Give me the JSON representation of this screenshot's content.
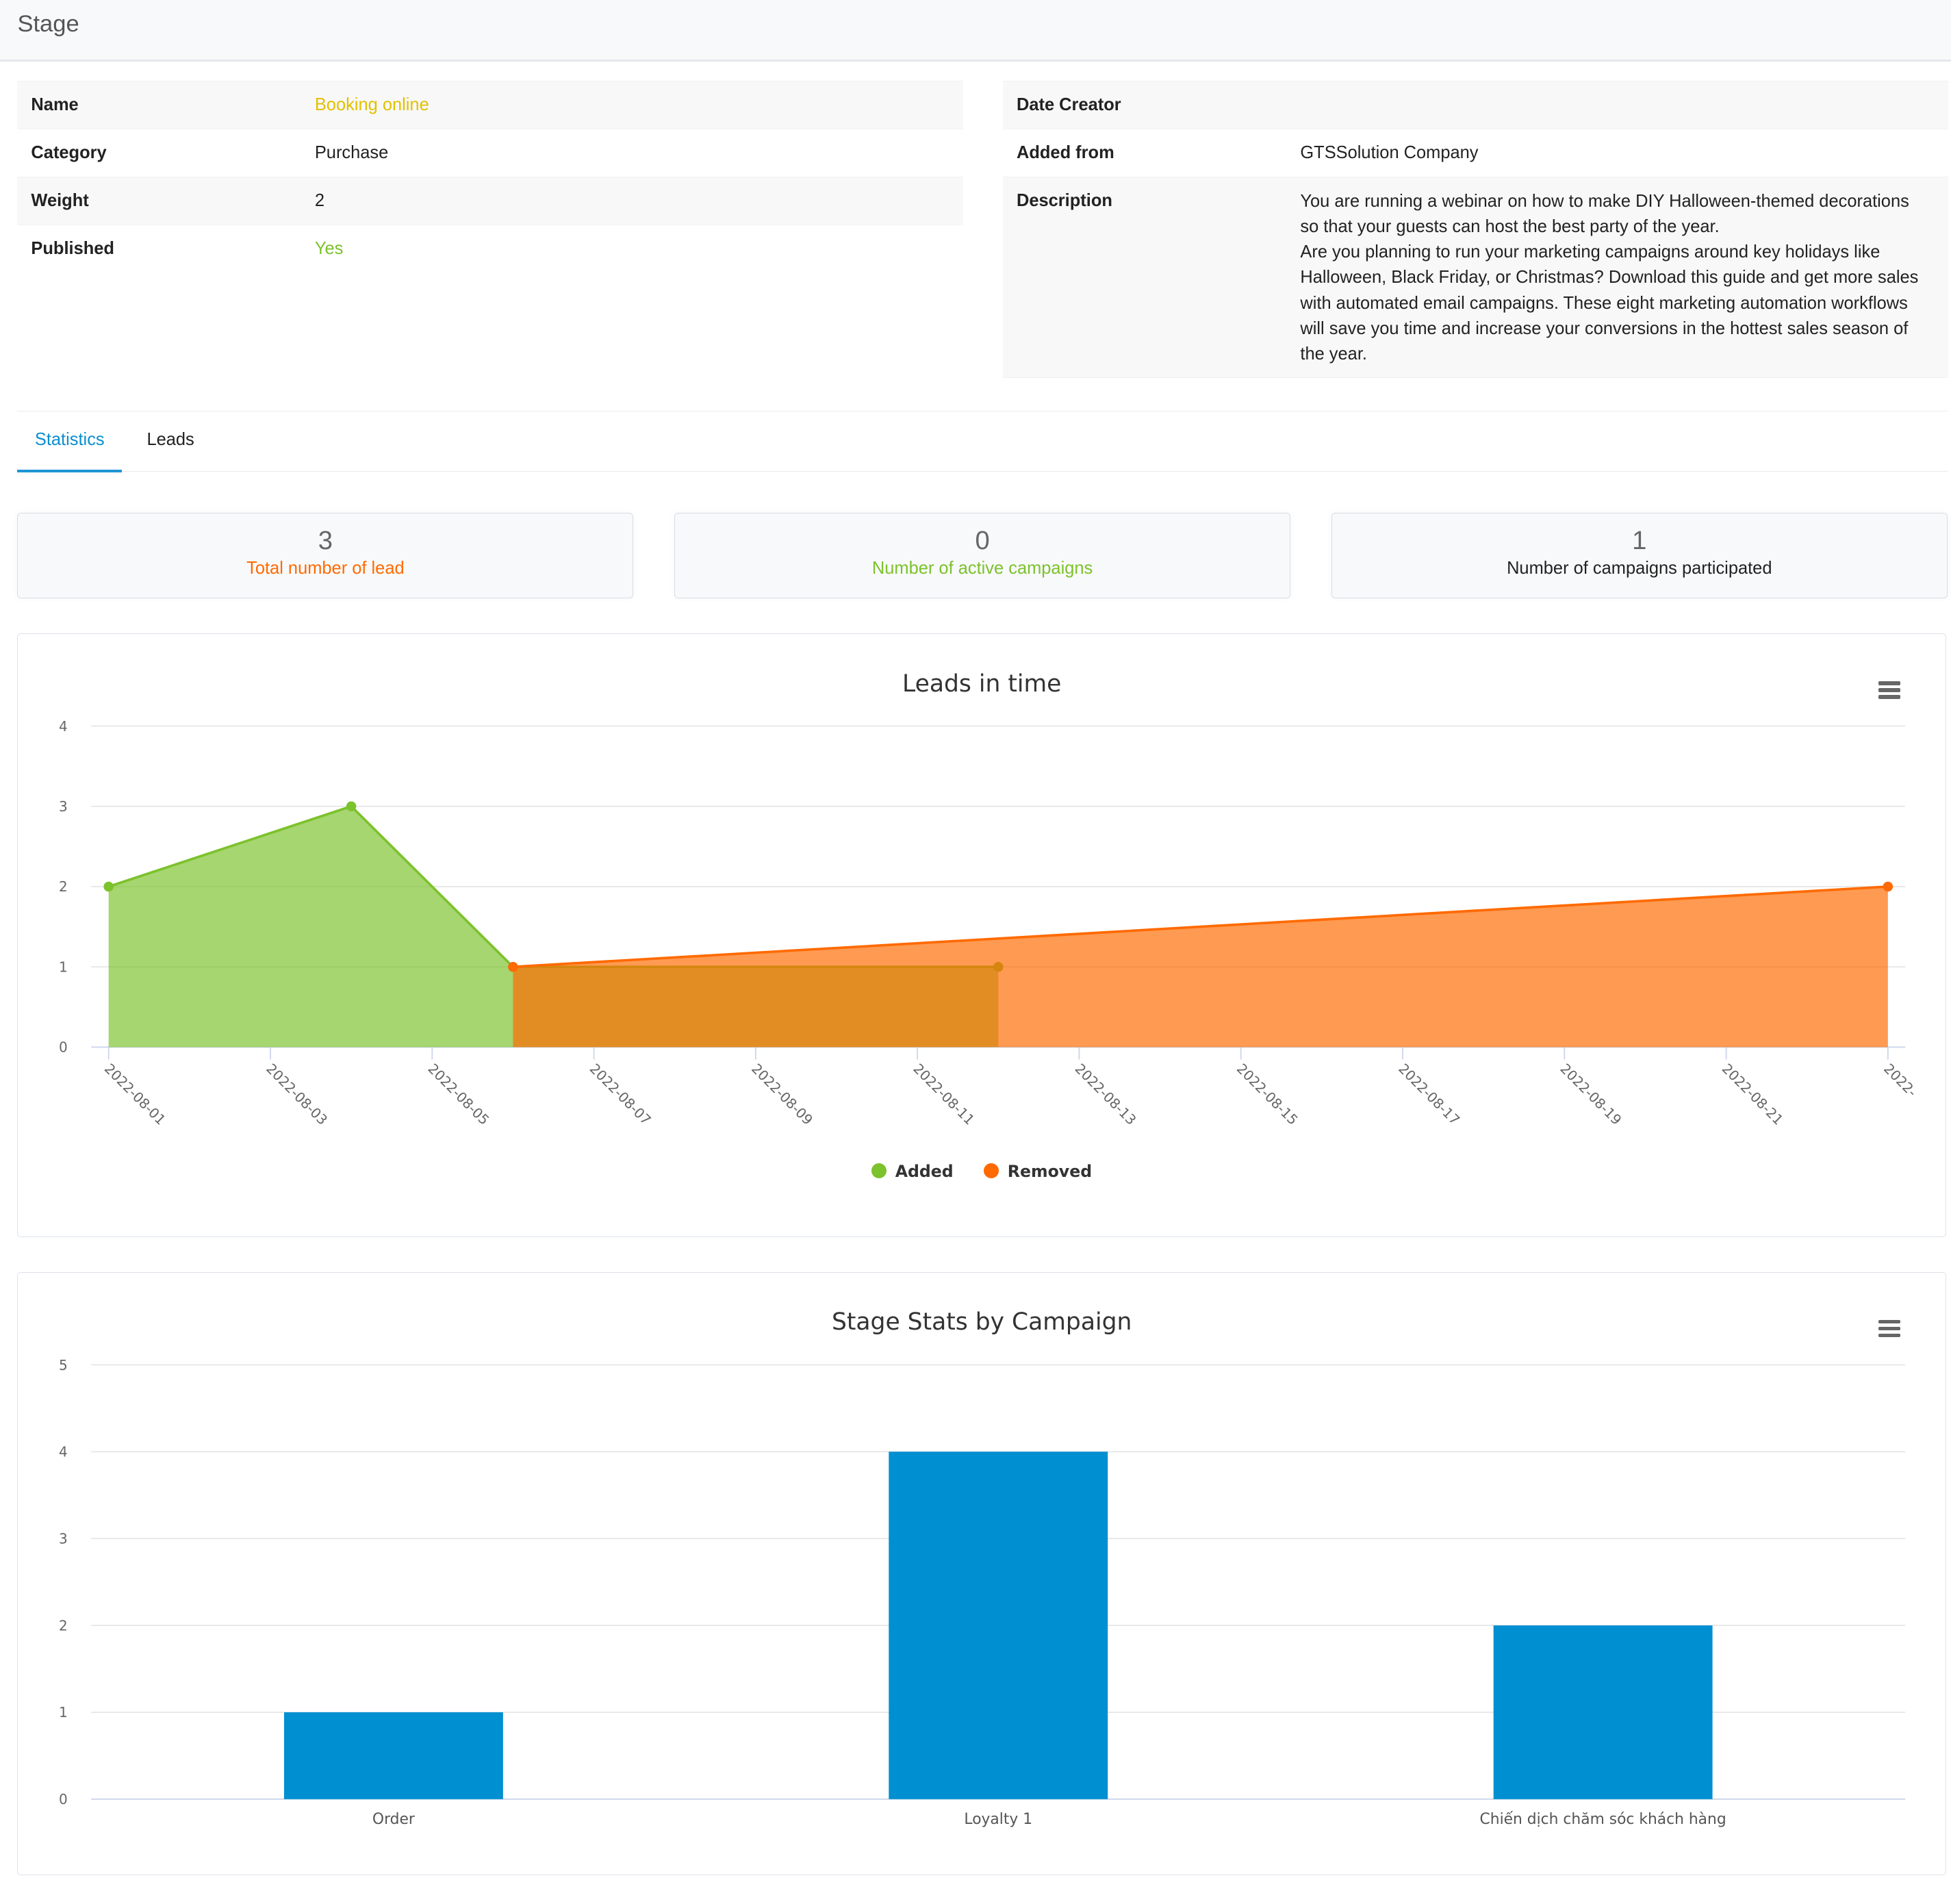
{
  "header": {
    "title": "Stage"
  },
  "details_left": [
    {
      "label": "Name",
      "value": "Booking online",
      "color": "#e2c100"
    },
    {
      "label": "Category",
      "value": "Purchase"
    },
    {
      "label": "Weight",
      "value": "2"
    },
    {
      "label": "Published",
      "value": "Yes",
      "color": "#7cc22c"
    }
  ],
  "details_right": {
    "date_creator_label": "Date Creator",
    "date_creator_value": "",
    "added_from_label": "Added from",
    "added_from_value": "GTSSolution Company",
    "description_label": "Description",
    "description_lines": [
      "You are running a webinar on how to make DIY Halloween-themed decorations",
      "so that your guests can host the best party of the year.",
      "Are you planning to run your marketing campaigns around key holidays like",
      "Halloween, Black Friday, or Christmas? Download this guide and get more sales",
      "with automated email campaigns. These eight marketing automation workflows",
      "will save you time and increase your conversions in the hottest sales season of",
      "the year."
    ]
  },
  "tabs": [
    {
      "label": "Statistics",
      "active": true
    },
    {
      "label": "Leads",
      "active": false
    }
  ],
  "stats": [
    {
      "value": "3",
      "label": "Total number of lead",
      "color": "#ff6a00"
    },
    {
      "value": "0",
      "label": "Number of active campaigns",
      "color": "#7cc22c"
    },
    {
      "value": "1",
      "label": "Number of campaigns participated",
      "color": "#222222"
    }
  ],
  "chart_data": [
    {
      "type": "area",
      "title": "Leads in time",
      "x_ticks": [
        "2022-08-01",
        "2022-08-03",
        "2022-08-05",
        "2022-08-07",
        "2022-08-09",
        "2022-08-11",
        "2022-08-13",
        "2022-08-15",
        "2022-08-17",
        "2022-08-19",
        "2022-08-21",
        "2022-"
      ],
      "ylim": [
        0,
        4
      ],
      "y_ticks": [
        "0",
        "1",
        "2",
        "3",
        "4"
      ],
      "grid": true,
      "legend": "bottom",
      "series": [
        {
          "name": "Added",
          "color": "#7cc22c",
          "points": [
            [
              "2022-08-01",
              2
            ],
            [
              "2022-08-04",
              3
            ],
            [
              "2022-08-06",
              1
            ],
            [
              "2022-08-12",
              1
            ]
          ]
        },
        {
          "name": "Removed",
          "color": "#ff6a00",
          "points": [
            [
              "2022-08-06",
              1
            ],
            [
              "2022-08-23",
              2
            ]
          ]
        }
      ]
    },
    {
      "type": "bar",
      "title": "Stage Stats by Campaign",
      "categories": [
        "Order",
        "Loyalty 1",
        "Chiến dịch chăm sóc khách hàng"
      ],
      "values": [
        1,
        4,
        2
      ],
      "color": "#008fd1",
      "ylim": [
        0,
        5
      ],
      "y_ticks": [
        "0",
        "1",
        "2",
        "3",
        "4",
        "5"
      ],
      "grid": true
    }
  ]
}
